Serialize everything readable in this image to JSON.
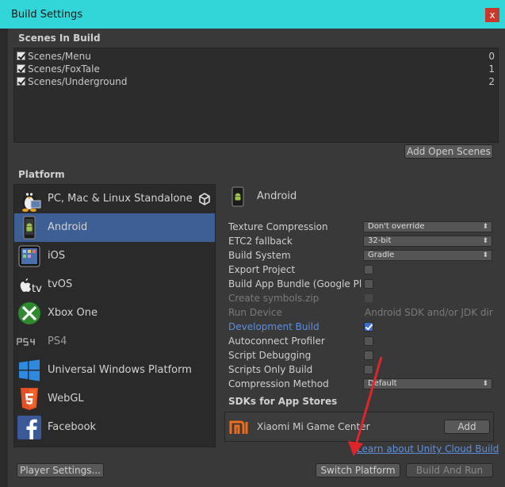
{
  "window": {
    "title": "Build Settings",
    "close_label": "x"
  },
  "scenes": {
    "heading": "Scenes In Build",
    "items": [
      {
        "name": "Scenes/Menu",
        "index": "0",
        "checked": true
      },
      {
        "name": "Scenes/FoxTale",
        "index": "1",
        "checked": true
      },
      {
        "name": "Scenes/Underground",
        "index": "2",
        "checked": true
      }
    ],
    "add_open_scenes_label": "Add Open Scenes"
  },
  "platform": {
    "heading": "Platform",
    "items": [
      {
        "label": "PC, Mac & Linux Standalone",
        "icon": "tux-icon",
        "selected": false
      },
      {
        "label": "Android",
        "icon": "android-phone-icon",
        "selected": true
      },
      {
        "label": "iOS",
        "icon": "ipad-icon",
        "selected": false
      },
      {
        "label": "tvOS",
        "icon": "apple-tv-icon",
        "selected": false
      },
      {
        "label": "Xbox One",
        "icon": "xbox-icon",
        "selected": false
      },
      {
        "label": "PS4",
        "icon": "ps4-icon",
        "selected": false
      },
      {
        "label": "Universal Windows Platform",
        "icon": "windows-icon",
        "selected": false
      },
      {
        "label": "WebGL",
        "icon": "html5-icon",
        "selected": false
      },
      {
        "label": "Facebook",
        "icon": "facebook-icon",
        "selected": false
      }
    ],
    "current_badge_icon": "unity-icon"
  },
  "settings": {
    "header_title": "Android",
    "texture_compression": {
      "label": "Texture Compression",
      "value": "Don't override"
    },
    "etc2_fallback": {
      "label": "ETC2 fallback",
      "value": "32-bit"
    },
    "build_system": {
      "label": "Build System",
      "value": "Gradle"
    },
    "export_project": {
      "label": "Export Project",
      "checked": false
    },
    "build_app_bundle": {
      "label": "Build App Bundle (Google Play)",
      "checked": false
    },
    "create_symbols": {
      "label": "Create symbols.zip",
      "checked": false,
      "disabled": true
    },
    "run_device": {
      "label": "Run Device",
      "value": "Android SDK and/or JDK dir"
    },
    "development_build": {
      "label": "Development Build",
      "checked": true
    },
    "autoconnect_profiler": {
      "label": "Autoconnect Profiler",
      "checked": false
    },
    "script_debugging": {
      "label": "Script Debugging",
      "checked": false
    },
    "scripts_only_build": {
      "label": "Scripts Only Build",
      "checked": false
    },
    "compression_method": {
      "label": "Compression Method",
      "value": "Default"
    }
  },
  "sdks": {
    "heading": "SDKs for App Stores",
    "items": [
      {
        "name": "Xiaomi Mi Game Center",
        "icon": "xiaomi-icon",
        "action": "Add"
      }
    ]
  },
  "cloud_build_link": "Learn about Unity Cloud Build",
  "buttons": {
    "player_settings": "Player Settings...",
    "switch_platform": "Switch Platform",
    "build_and_run": "Build And Run"
  },
  "colors": {
    "title_bar": "#33d6d8",
    "selection": "#3e5f93",
    "link": "#5d8fe0",
    "arrow_annotation": "#e0242a"
  }
}
